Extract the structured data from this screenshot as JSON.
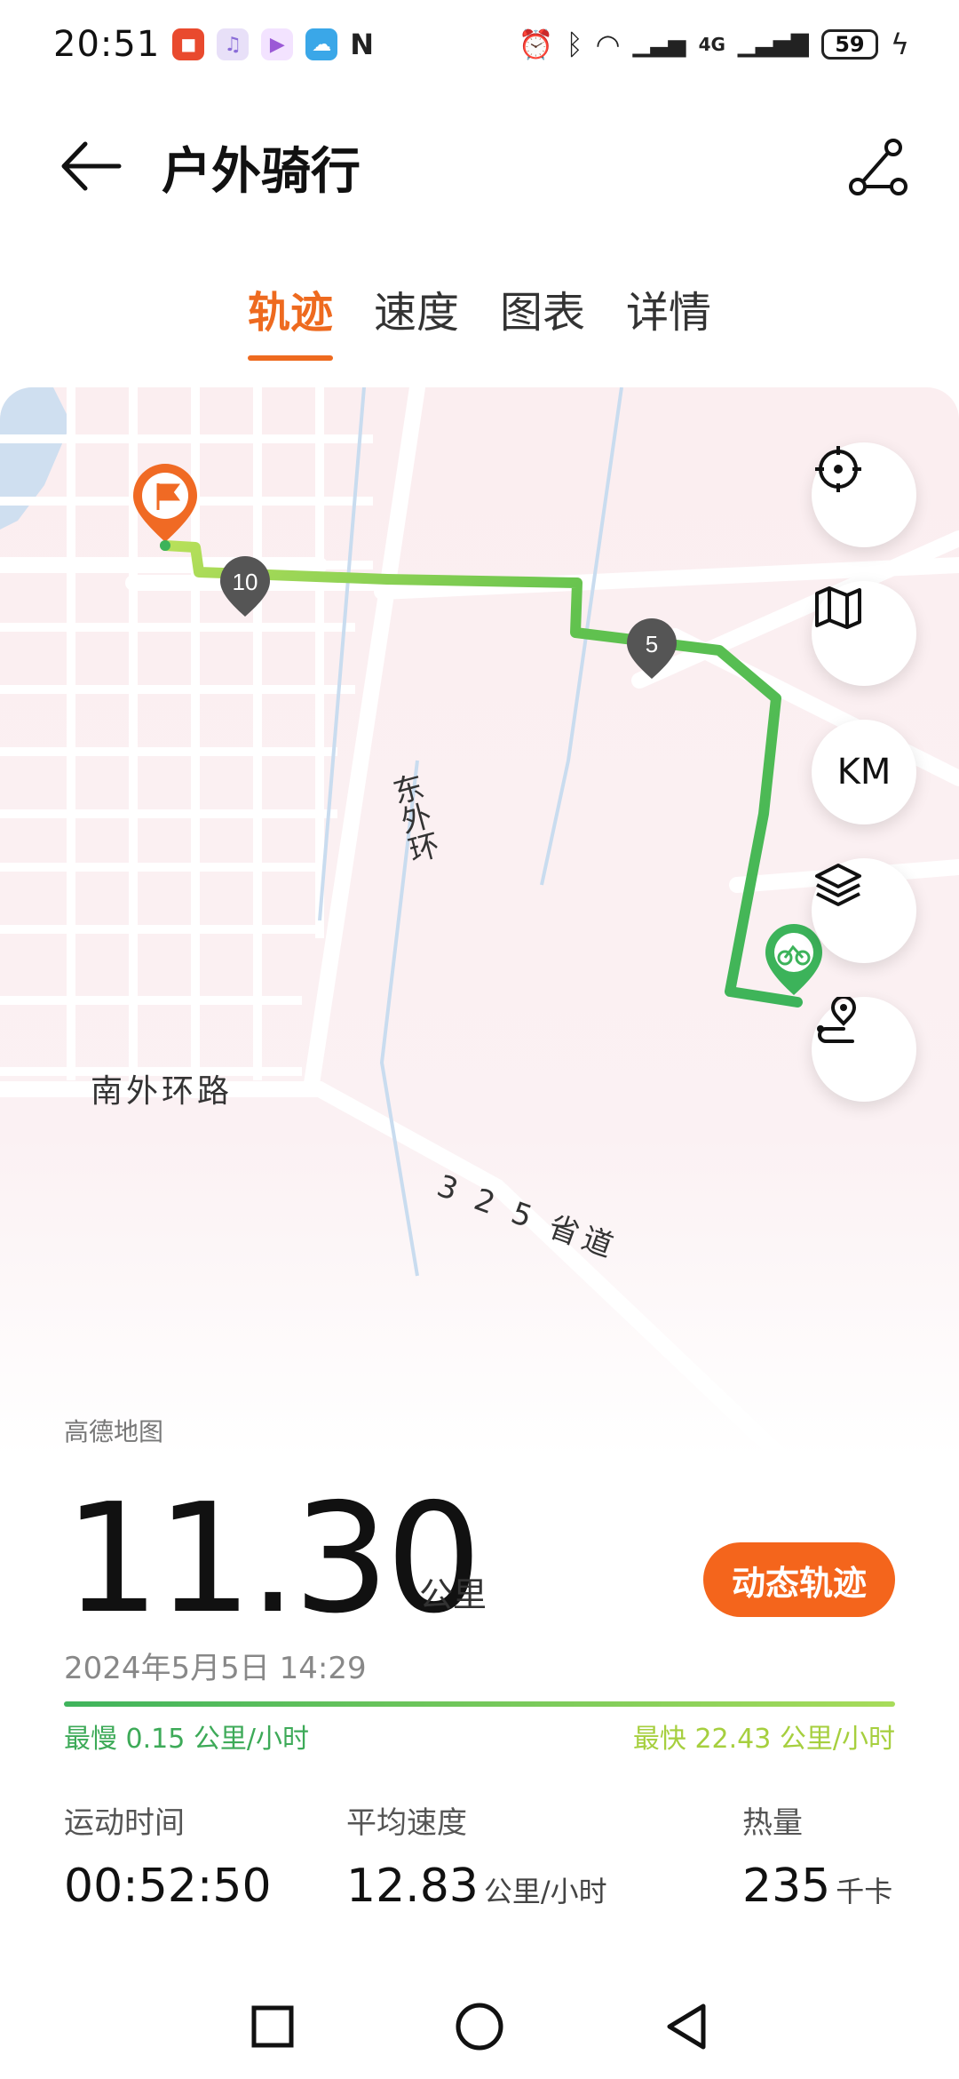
{
  "status_bar": {
    "time": "20:51",
    "battery": "59",
    "network_label": "4G"
  },
  "header": {
    "title": "户外骑行"
  },
  "tabs": [
    {
      "label": "轨迹",
      "active": true
    },
    {
      "label": "速度",
      "active": false
    },
    {
      "label": "图表",
      "active": false
    },
    {
      "label": "详情",
      "active": false
    }
  ],
  "map": {
    "road_labels": {
      "south_ring": "南外环路",
      "provincial_road": "3 2 5 省道",
      "east_ring": "东外环"
    },
    "km_markers": [
      "10",
      "5"
    ],
    "credit": "高德地图",
    "controls": {
      "km_toggle": "KM"
    },
    "route_colors": {
      "start": "#3cb35a",
      "end": "#b8e05a"
    }
  },
  "summary": {
    "distance": "11.30",
    "distance_unit": "公里",
    "dynamic_track_button": "动态轨迹",
    "date": "2024年5月5日 14:29",
    "slowest": "最慢 0.15 公里/小时",
    "fastest": "最快 22.43 公里/小时"
  },
  "stats": [
    {
      "label": "运动时间",
      "value": "00:52:50",
      "unit": ""
    },
    {
      "label": "平均速度",
      "value": "12.83",
      "unit": "公里/小时"
    },
    {
      "label": "热量",
      "value": "235",
      "unit": "千卡"
    }
  ],
  "colors": {
    "accent": "#ee6a1f",
    "button": "#f4651c"
  }
}
